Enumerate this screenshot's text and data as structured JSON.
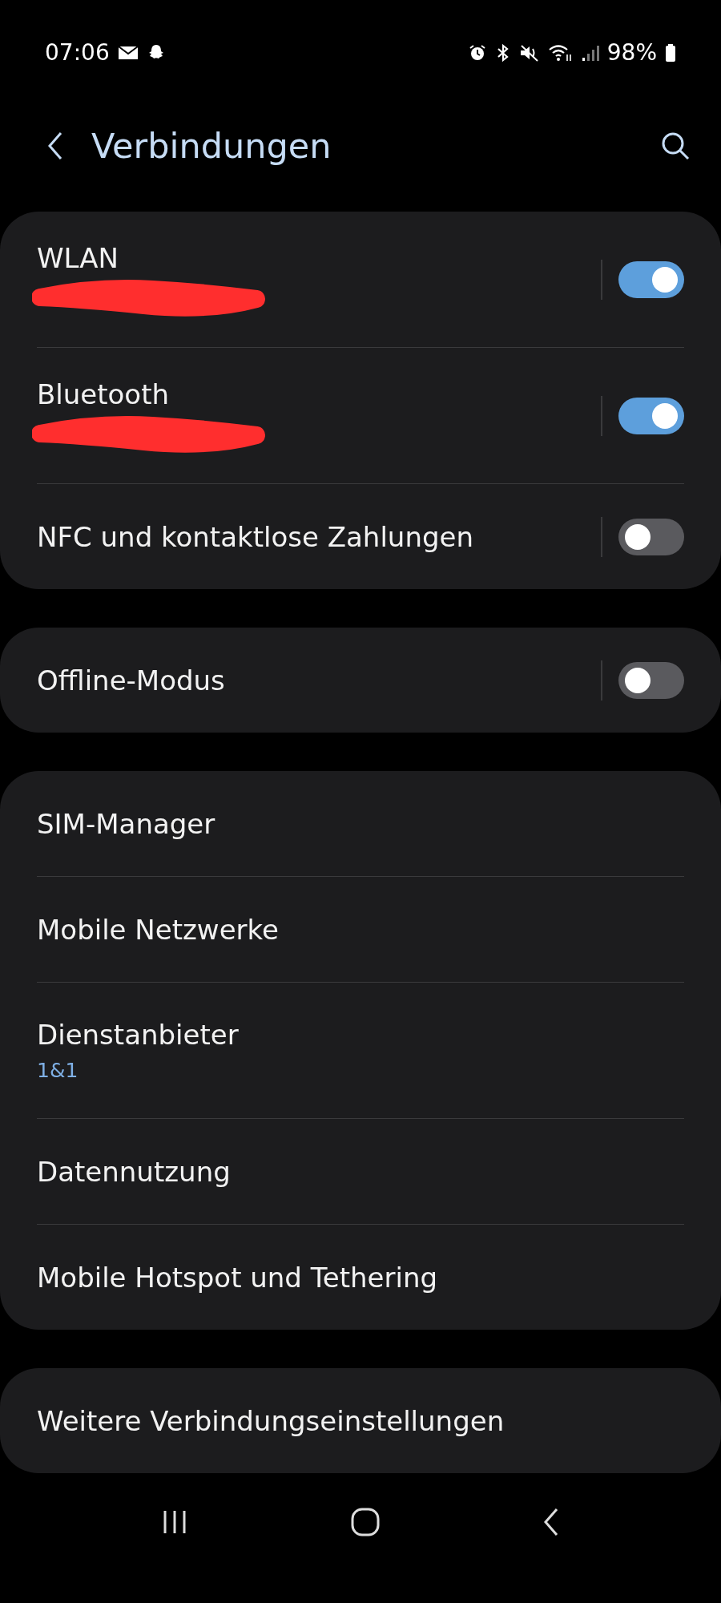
{
  "status_bar": {
    "time": "07:06",
    "battery": "98%"
  },
  "header": {
    "title": "Verbindungen"
  },
  "groups": [
    {
      "items": [
        {
          "label": "WLAN",
          "kind": "toggle",
          "on": true,
          "redacted": true
        },
        {
          "label": "Bluetooth",
          "kind": "toggle",
          "on": true,
          "redacted": true
        },
        {
          "label": "NFC und kontaktlose Zahlungen",
          "kind": "toggle",
          "on": false
        }
      ]
    },
    {
      "items": [
        {
          "label": "Offline-Modus",
          "kind": "toggle",
          "on": false
        }
      ]
    },
    {
      "items": [
        {
          "label": "SIM-Manager",
          "kind": "link"
        },
        {
          "label": "Mobile Netzwerke",
          "kind": "link"
        },
        {
          "label": "Dienstanbieter",
          "kind": "link",
          "subtitle": "1&1"
        },
        {
          "label": "Datennutzung",
          "kind": "link"
        },
        {
          "label": "Mobile Hotspot und Tethering",
          "kind": "link"
        }
      ]
    },
    {
      "items": [
        {
          "label": "Weitere Verbindungseinstellungen",
          "kind": "link"
        }
      ]
    }
  ]
}
